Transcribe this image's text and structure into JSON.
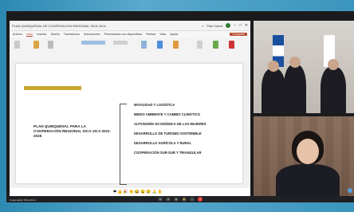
{
  "window": {
    "title": "PLAN QUINQUENAL DE COOPERACION REGIONAL SICA-JICA",
    "user": "Plan Cabot"
  },
  "ribbon_tabs": [
    "Archivo",
    "Inicio",
    "Insertar",
    "Diseño",
    "Transiciones",
    "Animaciones",
    "Presentación con diapositivas",
    "Revisar",
    "Vista",
    "Ayuda"
  ],
  "ribbon_selected": "Inicio",
  "share_label": "Compartir",
  "slide": {
    "plan_title": "PLAN QUINQUENAL PARA LA COOPERACIÓN REGIONAL SICA-JICA 2021-2025",
    "items": [
      "MOVILIDAD Y LOGÍSTICA",
      "MEDIO AMBIENTE Y CAMBIO CLIMÁTICO",
      "AUTONOMÍA ECONÓMICA DE LAS MUJERES",
      "DESARROLLO DE TURISMO SOSTENIBLE",
      "DESARROLLO AGRÍCOLA Y RURAL",
      "COOPERACIÓN SUR-SUR Y TRIANGULAR"
    ]
  },
  "reactions": "❤👍🎉👏😂😮😢🙏✋",
  "meeting_name": "Cooperación SICA-JICA"
}
